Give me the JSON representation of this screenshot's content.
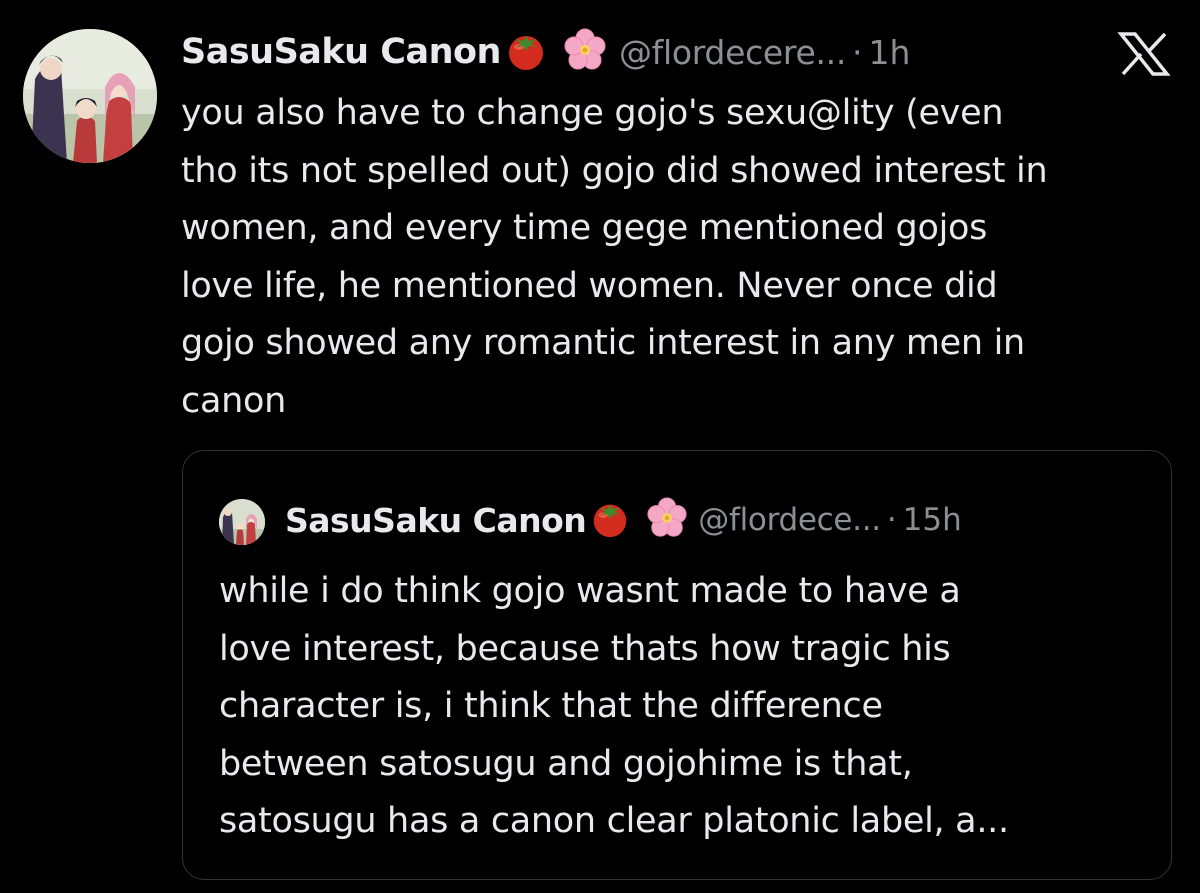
{
  "tweet": {
    "author_name": "SasuSaku Canon",
    "name_emojis": [
      "tomato-emoji",
      "cherry-blossom-emoji"
    ],
    "handle": "@flordecere...",
    "separator": "·",
    "time": "1h",
    "text_lines": [
      "you also have to change gojo's sexu@lity (even",
      "tho its not spelled out) gojo did showed interest in",
      "women, and every time gege mentioned gojos",
      "love life, he mentioned women. Never once did",
      "gojo showed any romantic interest in any men in",
      "canon"
    ]
  },
  "quoted_tweet": {
    "author_name": "SasuSaku Canon",
    "name_emojis": [
      "tomato-emoji",
      "cherry-blossom-emoji"
    ],
    "handle": "@flordece...",
    "separator": "·",
    "time": "15h",
    "text_lines": [
      "while i do think gojo wasnt made to have a",
      "love interest, because thats how tragic his",
      "character is, i think that the difference",
      "between satosugu and gojohime is that,",
      "satosugu has a canon clear platonic label, a..."
    ]
  },
  "brand": {
    "logo_icon": "x-logo-icon"
  },
  "colors": {
    "background": "#000000",
    "text_primary": "#e7e9ea",
    "text_secondary": "#8b9096",
    "border": "#2f3336"
  }
}
